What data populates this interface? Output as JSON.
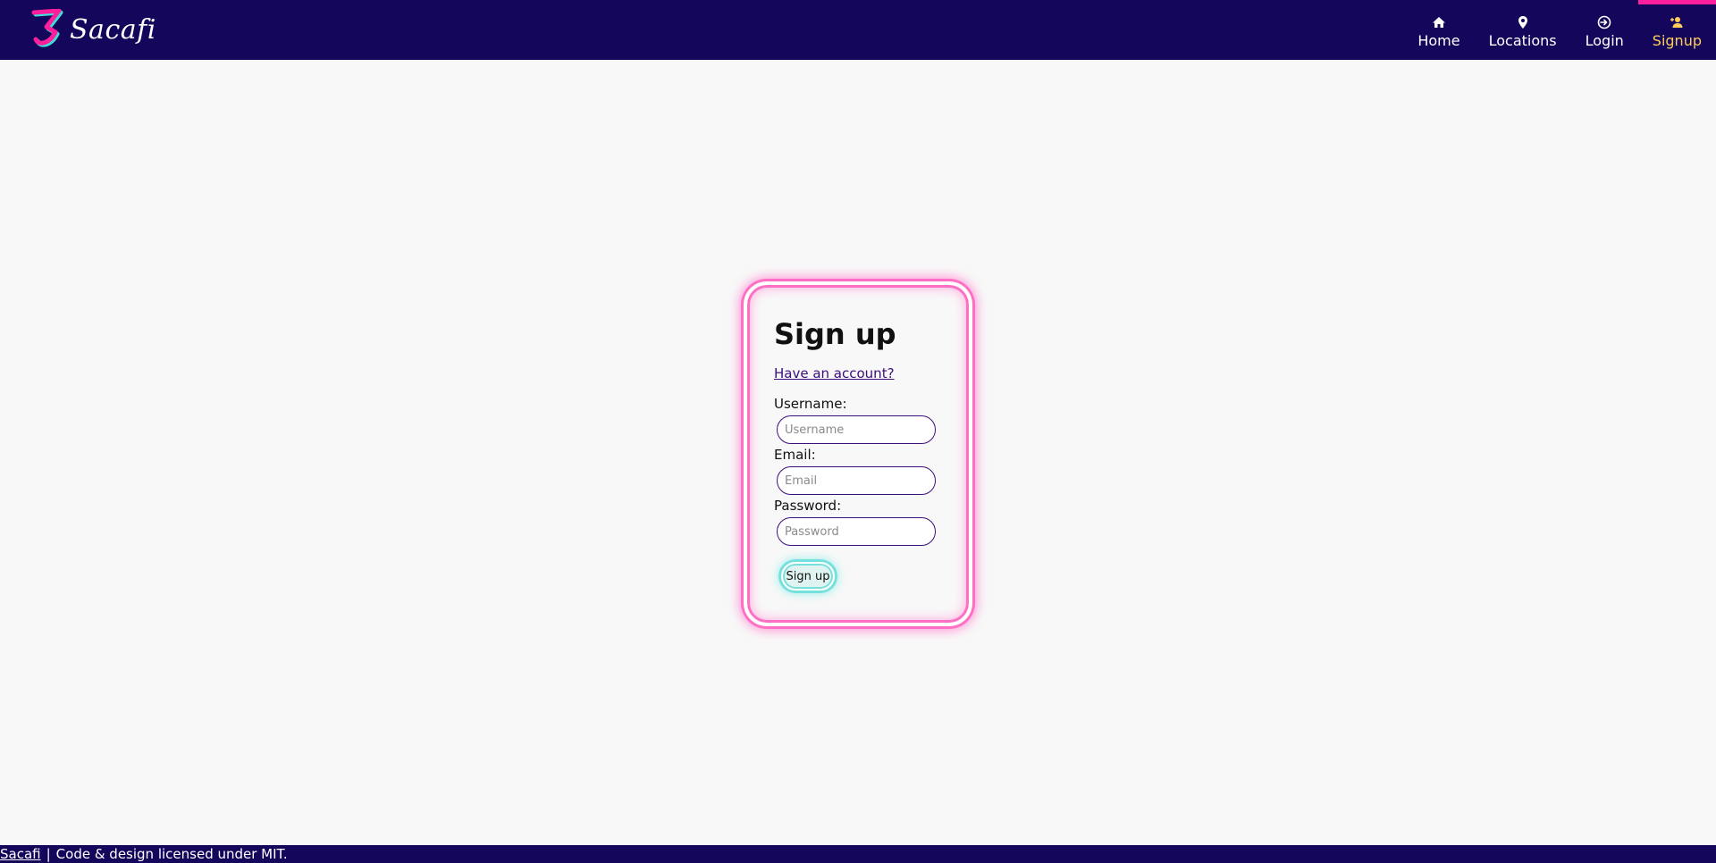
{
  "header": {
    "brand": {
      "name": "Sacafi",
      "logo_icon": "sacafi-logo-icon"
    },
    "nav": [
      {
        "label": "Home",
        "icon": "home-icon"
      },
      {
        "label": "Locations",
        "icon": "map-pin-icon"
      },
      {
        "label": "Login",
        "icon": "login-icon"
      },
      {
        "label": "Signup",
        "icon": "add-user-icon",
        "active": true
      }
    ]
  },
  "form": {
    "title": "Sign up",
    "have_account_link": "Have an account?",
    "username": {
      "label": "Username:",
      "placeholder": "Username",
      "value": ""
    },
    "email": {
      "label": "Email:",
      "placeholder": "Email",
      "value": ""
    },
    "password": {
      "label": "Password:",
      "placeholder": "Password",
      "value": ""
    },
    "submit_label": "Sign up"
  },
  "footer": {
    "link": "Sacafi",
    "separator": "|",
    "text": "Code & design licensed under MIT."
  },
  "colors": {
    "nav_background": "#13065b",
    "active_nav_text": "#ffce5c",
    "active_nav_indicator": "#ff1e9c",
    "card_glow": "#ff6fc6",
    "button_glow": "#76e0dc",
    "link": "#3c0e7a"
  }
}
